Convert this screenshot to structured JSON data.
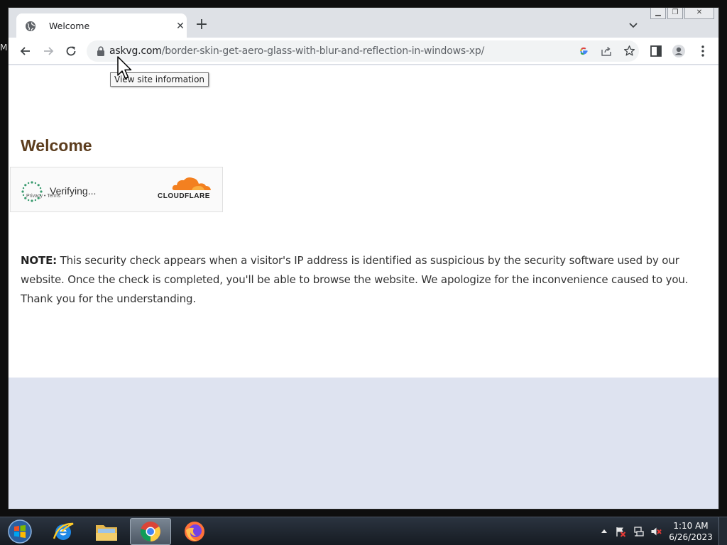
{
  "desktop": {
    "edge_text": "M"
  },
  "tab": {
    "title": "Welcome",
    "favicon": "globe-icon",
    "close_glyph": "✕"
  },
  "toolbar": {
    "new_tab_glyph": "+",
    "url_host": "askvg.com",
    "url_path": "/border-skin-get-aero-glass-with-blur-and-reflection-in-windows-xp/"
  },
  "tooltip": {
    "text": "View site information"
  },
  "page": {
    "heading": "Welcome",
    "verifying_text": "Verifying...",
    "cloudflare_word": "CLOUDFLARE",
    "privacy_link": "Privacy",
    "link_separator": "•",
    "terms_link": "Terms",
    "note_label": "NOTE:",
    "note_text": " This security check appears when a visitor's IP address is identified as suspicious by the security software used by our website. Once the check is completed, you'll be able to browse the website. We apologize for the inconvenience caused to you. Thank you for the understanding."
  },
  "taskbar": {
    "time": "1:10 AM",
    "date": "6/26/2023",
    "items": [
      "start-orb",
      "internet-explorer",
      "file-explorer",
      "google-chrome",
      "firefox"
    ]
  },
  "colors": {
    "heading": "#5c3d1e",
    "cloudflare_orange": "#f38020",
    "spinner_green": "#3a9b6f",
    "page_bg_below": "#dee3f0"
  }
}
